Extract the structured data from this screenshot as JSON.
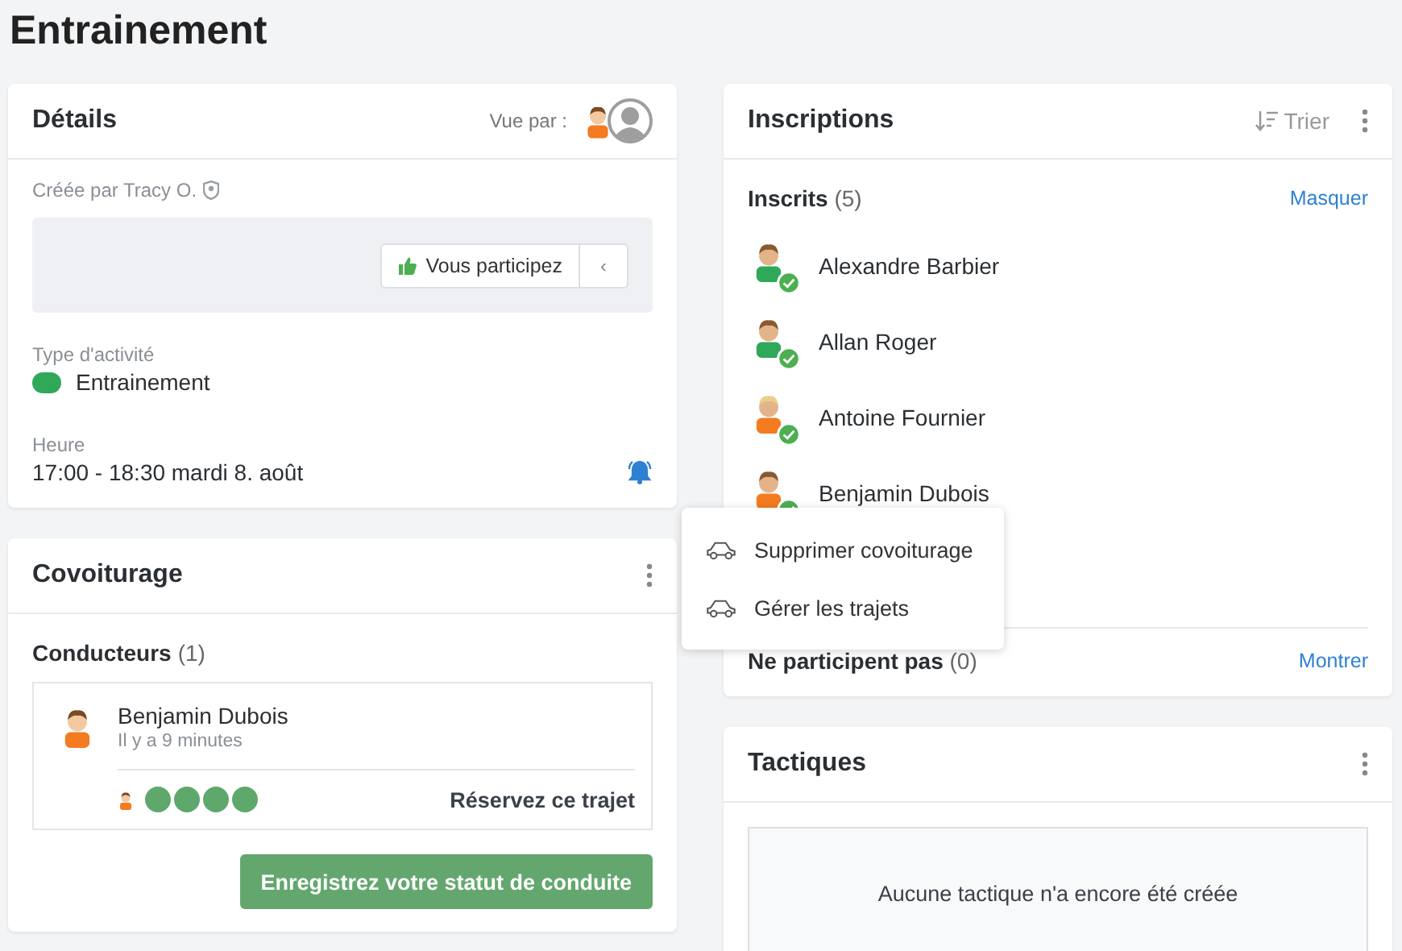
{
  "page_title": "Entrainement",
  "details": {
    "title": "Détails",
    "viewed_by_label": "Vue par :",
    "viewers": [
      {
        "kind": "avatar",
        "color": "#f47b20"
      },
      {
        "kind": "placeholder",
        "color": "#9e9e9e"
      }
    ],
    "created_by": "Créée par Tracy O.",
    "participation_button": "Vous participez",
    "collapse_button": "‹",
    "activity_type_label": "Type d'activité",
    "activity_type": {
      "name": "Entrainement",
      "color": "#2fa85a"
    },
    "time_label": "Heure",
    "time": "17:00 - 18:30 mardi 8. août",
    "reminder_on": true
  },
  "carpool": {
    "title": "Covoiturage",
    "drivers_label": "Conducteurs",
    "drivers_count": "(1)",
    "drivers": [
      {
        "name": "Benjamin Dubois",
        "time": "Il y a 9 minutes",
        "color": "#f47b20",
        "passengers": [
          {
            "color": "#f47b20"
          }
        ],
        "seats": [
          {
            "free": true
          },
          {
            "free": true
          },
          {
            "free": true
          },
          {
            "free": true
          }
        ],
        "book_label": "Réservez ce trajet"
      }
    ],
    "register_button": "Enregistrez votre statut de conduite"
  },
  "menu": {
    "items": [
      {
        "label": "Supprimer covoiturage"
      },
      {
        "label": "Gérer les trajets"
      }
    ]
  },
  "registrations": {
    "title": "Inscriptions",
    "sort_button": "Trier",
    "registered_label": "Inscrits",
    "registered_count": "(5)",
    "hide_link": "Masquer",
    "registered": [
      {
        "name": "Alexandre Barbier",
        "color": "#2fa85a",
        "confirmed": true
      },
      {
        "name": "Allan Roger",
        "color": "#2fa85a",
        "confirmed": true
      },
      {
        "name": "Antoine Fournier",
        "color": "#f47b20",
        "confirmed": true
      },
      {
        "name": "Benjamin Dubois",
        "color": "#f47b20",
        "confirmed": true
      }
    ],
    "not_participating_label": "Ne participent pas",
    "not_participating_count": "(0)",
    "show_link": "Montrer"
  },
  "tactics": {
    "title": "Tactiques",
    "empty_text": "Aucune tactique n'a encore été créée"
  }
}
